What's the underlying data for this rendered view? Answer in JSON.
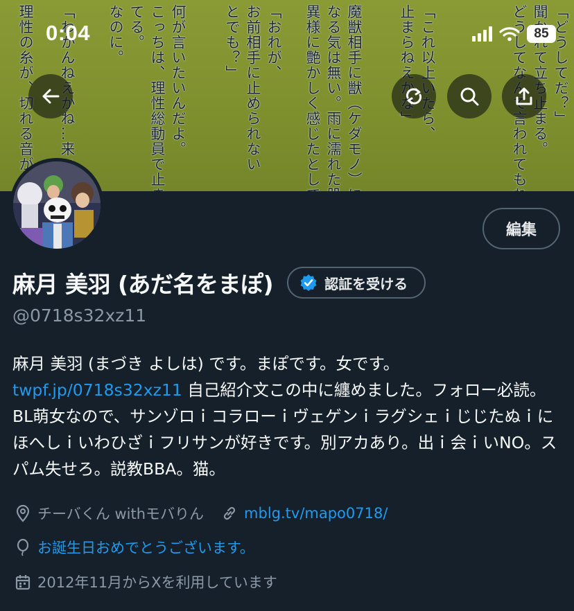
{
  "status_bar": {
    "time": "0:04",
    "battery": "85"
  },
  "banner": {
    "columns": [
      "「どうしてだ？」",
      "聞かれて立ち止まる。",
      "どうしてなんて言われてもね。",
      "「これ以上いたら、",
      "止まらねえかな」",
      "魔獣相手に獣（ケダモノ）に",
      "なる気は無い。雨に濡れた肌が",
      "異様に艶かしく感じたとしても",
      "「おれが、",
      "お前相手に止められない",
      "とでも？」",
      "何が言いたいんだよ。",
      "こっちは、理性総動員で止まっ",
      "てる。",
      "なのに。",
      "「わかんねえかね…来いよ",
      "理性の糸が、切れる音がした"
    ]
  },
  "nav": {
    "back_icon": "arrow-left-icon",
    "refresh_icon": "refresh-icon",
    "search_icon": "search-icon",
    "share_icon": "share-icon"
  },
  "profile": {
    "edit_label": "編集",
    "display_name": "麻月 美羽 (あだ名をまぽ)",
    "verify_label": "認証を受ける",
    "handle": "@0718s32xz11",
    "bio_before": "麻月 美羽 (まづき よしは) です。まぽです。女です。",
    "bio_link": "twpf.jp/0718s32xz11",
    "bio_after": " 自己紹介文この中に纏めました。フォロー必読。BL萌女なので、サンゾロｉコラローｉヴェゲンｉラグシェｉじじたぬｉにほへしｉいわひざｉフリサンが好きです。別アカあり。出ｉ会ｉいNO。スパム失せろ。説教BBA。猫。",
    "location": "チーバくん withモバりん",
    "website": "mblg.tv/mapo0718/",
    "birthday": "お誕生日おめでとうございます。",
    "joined": "2012年11月からXを利用しています"
  },
  "colors": {
    "background": "#15202b",
    "accent": "#1d9bf0",
    "muted": "#8b98a5",
    "banner": "#84942f"
  }
}
